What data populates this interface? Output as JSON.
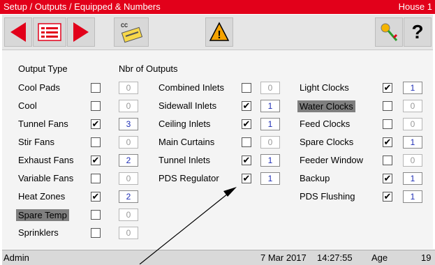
{
  "title": "Setup / Outputs / Equipped & Numbers",
  "house": "House 1",
  "toolbar": {
    "icons": [
      "arrow-left-icon",
      "list-icon",
      "arrow-right-icon",
      "cc-card-icon",
      "warning-icon",
      "key-icon",
      "help-icon"
    ],
    "cc_label": "cc",
    "help_label": "?",
    "warning_label": "!"
  },
  "headers": {
    "output_type": "Output Type",
    "nbr": "Nbr of Outputs"
  },
  "col1": [
    {
      "label": "Cool Pads",
      "checked": false,
      "value": "0"
    },
    {
      "label": "Cool",
      "checked": false,
      "value": "0"
    },
    {
      "label": "Tunnel Fans",
      "checked": true,
      "value": "3"
    },
    {
      "label": "Stir Fans",
      "checked": false,
      "value": "0"
    },
    {
      "label": "Exhaust Fans",
      "checked": true,
      "value": "2"
    },
    {
      "label": "Variable Fans",
      "checked": false,
      "value": "0"
    },
    {
      "label": "Heat Zones",
      "checked": true,
      "value": "2"
    },
    {
      "label": "Spare Temp",
      "checked": false,
      "value": "0",
      "highlight": true
    },
    {
      "label": "Sprinklers",
      "checked": false,
      "value": "0"
    }
  ],
  "col2": [
    {
      "label": "Combined Inlets",
      "checked": false,
      "value": "0"
    },
    {
      "label": "Sidewall Inlets",
      "checked": true,
      "value": "1"
    },
    {
      "label": "Ceiling Inlets",
      "checked": true,
      "value": "1"
    },
    {
      "label": "Main Curtains",
      "checked": false,
      "value": "0"
    },
    {
      "label": "Tunnel Inlets",
      "checked": true,
      "value": "1"
    },
    {
      "label": "PDS Regulator",
      "checked": true,
      "value": "1"
    }
  ],
  "col3": [
    {
      "label": "Light Clocks",
      "checked": true,
      "value": "1"
    },
    {
      "label": "Water Clocks",
      "checked": false,
      "value": "0",
      "highlight": true
    },
    {
      "label": "Feed Clocks",
      "checked": false,
      "value": "0"
    },
    {
      "label": "Spare Clocks",
      "checked": true,
      "value": "1"
    },
    {
      "label": "Feeder Window",
      "checked": false,
      "value": "0"
    },
    {
      "label": "Backup",
      "checked": true,
      "value": "1"
    },
    {
      "label": "PDS Flushing",
      "checked": true,
      "value": "1"
    }
  ],
  "status": {
    "user": "Admin",
    "date": "7 Mar 2017",
    "time": "14:27:55",
    "age_label": "Age",
    "age": "19"
  },
  "colors": {
    "title": "#e2001a",
    "arrow": "#e2001a",
    "value_on": "#1d2db5",
    "warning": "#f5a300"
  }
}
